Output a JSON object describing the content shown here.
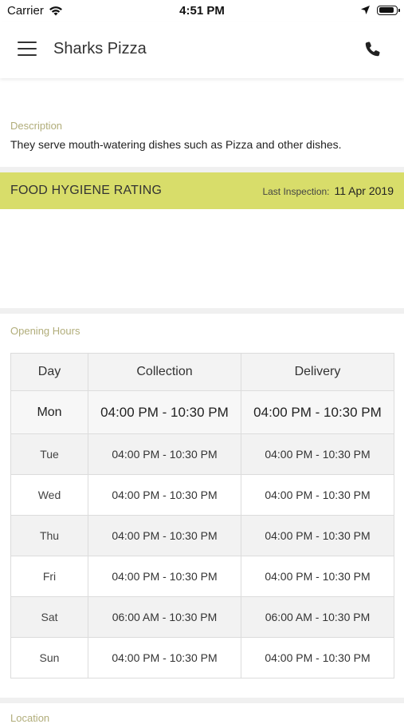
{
  "status_bar": {
    "carrier": "Carrier",
    "time": "4:51 PM",
    "battery_level": 0.9
  },
  "header": {
    "title": "Sharks Pizza",
    "menu_icon": "hamburger-icon",
    "call_icon": "phone-icon"
  },
  "description": {
    "label": "Description",
    "text": "They serve mouth-watering dishes such as Pizza and other dishes."
  },
  "hygiene": {
    "title": "FOOD HYGIENE RATING",
    "last_inspection_label": "Last Inspection:",
    "last_inspection_date": "11 Apr 2019",
    "bar_color": "#d8dd6a"
  },
  "opening_hours": {
    "label": "Opening Hours",
    "columns": [
      "Day",
      "Collection",
      "Delivery"
    ],
    "rows": [
      {
        "day": "Mon",
        "collection": "04:00 PM - 10:30 PM",
        "delivery": "04:00 PM - 10:30 PM"
      },
      {
        "day": "Tue",
        "collection": "04:00 PM - 10:30 PM",
        "delivery": "04:00 PM - 10:30 PM"
      },
      {
        "day": "Wed",
        "collection": "04:00 PM - 10:30 PM",
        "delivery": "04:00 PM - 10:30 PM"
      },
      {
        "day": "Thu",
        "collection": "04:00 PM - 10:30 PM",
        "delivery": "04:00 PM - 10:30 PM"
      },
      {
        "day": "Fri",
        "collection": "04:00 PM - 10:30 PM",
        "delivery": "04:00 PM - 10:30 PM"
      },
      {
        "day": "Sat",
        "collection": "06:00 AM - 10:30 PM",
        "delivery": "06:00 AM - 10:30 PM"
      },
      {
        "day": "Sun",
        "collection": "04:00 PM - 10:30 PM",
        "delivery": "04:00 PM - 10:30 PM"
      }
    ]
  },
  "location": {
    "label": "Location"
  },
  "colors": {
    "section_label": "#b1ad7a",
    "accent": "#d8dd6a"
  }
}
